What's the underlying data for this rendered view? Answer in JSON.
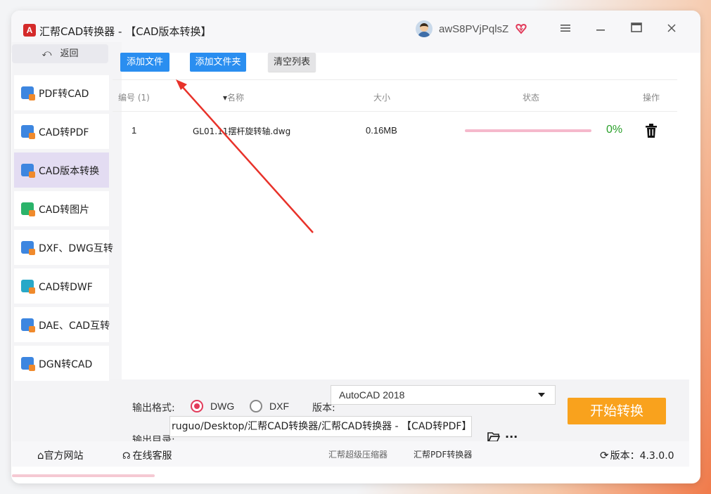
{
  "app": {
    "title": "汇帮CAD转换器 - 【CAD版本转换】",
    "logo_letter": "A",
    "username": "awS8PVjPqlsZ"
  },
  "sidebar": {
    "back_label": "返回",
    "items": [
      {
        "label": "PDF转CAD",
        "active": false
      },
      {
        "label": "CAD转PDF",
        "active": false
      },
      {
        "label": "CAD版本转换",
        "active": true
      },
      {
        "label": "CAD转图片",
        "active": false
      },
      {
        "label": "DXF、DWG互转",
        "active": false
      },
      {
        "label": "CAD转DWF",
        "active": false
      },
      {
        "label": "DAE、CAD互转",
        "active": false
      },
      {
        "label": "DGN转CAD",
        "active": false
      }
    ]
  },
  "toolbar": {
    "add_file": "添加文件",
    "add_folder": "添加文件夹",
    "clear_list": "清空列表"
  },
  "table": {
    "headers": {
      "index": "编号 (1)",
      "name": "名称",
      "size": "大小",
      "status": "状态",
      "action": "操作"
    },
    "rows": [
      {
        "index": "1",
        "name": "GL01.11摆杆旋转轴.dwg",
        "size": "0.16MB",
        "progress": 0,
        "percent": "0%"
      }
    ]
  },
  "output": {
    "format_label": "输出格式:",
    "format_options": [
      "DWG",
      "DXF"
    ],
    "format_selected": "DWG",
    "version_label": "版本:",
    "version_value": "AutoCAD 2018",
    "dir_label": "输出目录:",
    "dir_value": "ruguo/Desktop/汇帮CAD转换器/汇帮CAD转换器 - 【CAD转PDF】",
    "start_button": "开始转换"
  },
  "footer": {
    "website": "官方网站",
    "support": "在线客服",
    "link1": "汇帮超级压缩器",
    "link2": "汇帮PDF转换器",
    "version": "版本：4.3.0.0"
  },
  "colors": {
    "accent_blue": "#2a8ef0",
    "start_orange": "#f9a21d",
    "radio_red": "#e23b5a",
    "percent_green": "#2aa02a",
    "arrow_red": "#e8322a"
  }
}
